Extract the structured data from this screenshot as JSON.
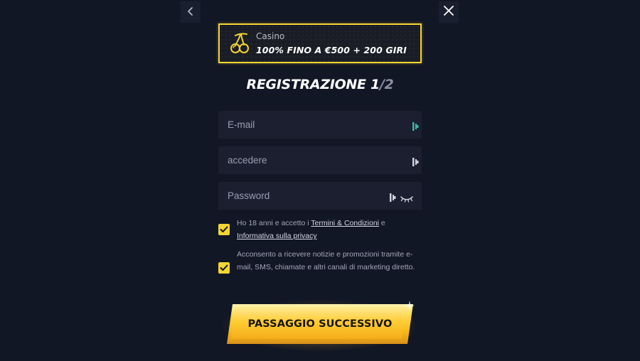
{
  "nav": {
    "back_icon": "chevron-left-icon",
    "close_icon": "close-icon"
  },
  "promo": {
    "icon": "cherries-icon",
    "category": "Casino",
    "offer": "100% FINO A €500 + 200 GIRI",
    "accent_color": "#f3d531"
  },
  "title": {
    "main": "REGISTRAZIONE 1",
    "total": "/2"
  },
  "form": {
    "email": {
      "placeholder": "E-mail",
      "value": "",
      "icon": "password-manager-icon"
    },
    "login": {
      "placeholder": "accedere",
      "value": "",
      "icon": "password-manager-icon"
    },
    "password": {
      "placeholder": "Password",
      "value": "",
      "icon": "password-manager-icon",
      "toggle_icon": "eye-closed-icon"
    }
  },
  "consents": {
    "terms": {
      "checked": true,
      "text_before": "Ho 18 anni e accetto i ",
      "terms_link": "Termini & Condizioni",
      "text_mid": " e ",
      "privacy_link": "Informativa sulla privacy"
    },
    "marketing": {
      "checked": true,
      "text": "Acconsento a ricevere notizie e promozioni tramite e-mail, SMS, chiamate e altri canali di marketing diretto."
    }
  },
  "cta": {
    "label": "PASSAGGIO SUCCESSIVO",
    "color": "#ffcc33"
  },
  "colors": {
    "background": "#121726",
    "field": "#1b1f2f",
    "checkbox": "#f3d531"
  }
}
